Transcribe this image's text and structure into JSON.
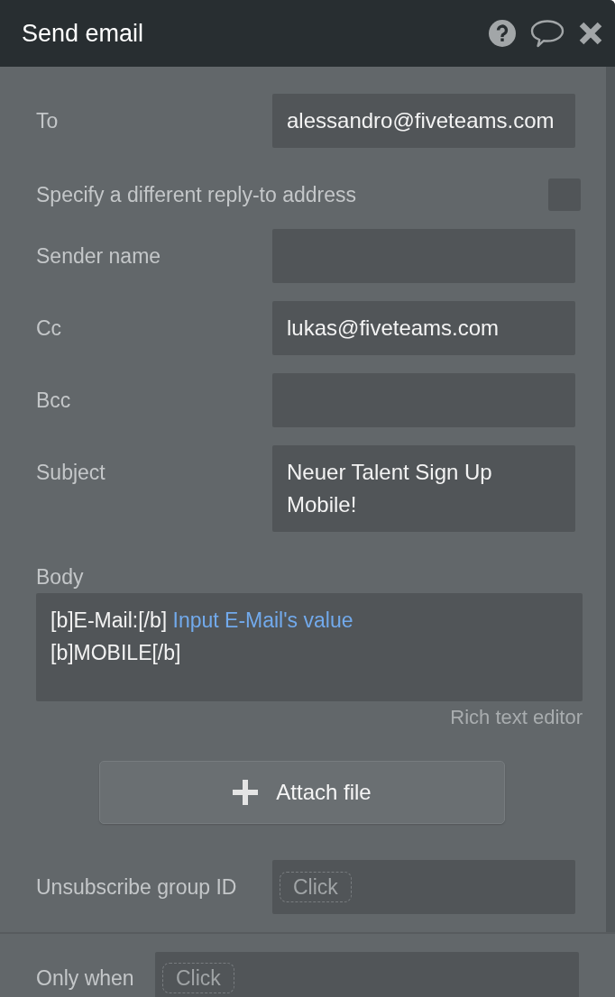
{
  "window": {
    "title": "Send email"
  },
  "fields": [
    {
      "kind": "text",
      "label": "To",
      "value": "alessandro@fiveteams.com"
    },
    {
      "kind": "checkbox",
      "label": "Specify a different reply-to address",
      "checked": false
    },
    {
      "kind": "text",
      "label": "Sender name"
    },
    {
      "kind": "text",
      "label": "Cc",
      "value": "lukas@fiveteams.com"
    },
    {
      "kind": "text",
      "label": "Bcc"
    },
    {
      "kind": "text",
      "label": "Subject",
      "value": "Neuer Talent Sign Up Mobile!"
    }
  ],
  "body": {
    "label": "Body",
    "lines": [
      {
        "segments": [
          {
            "kind": "plain",
            "text": "[b]E-Mail:[/b]"
          },
          {
            "kind": "expression",
            "text": "Input E-Mail's value"
          }
        ]
      },
      {
        "segments": [
          {
            "kind": "plain",
            "text": "[b]MOBILE[/b]"
          }
        ]
      }
    ],
    "editor_link": "Rich text editor"
  },
  "attach_button": {
    "label": "Attach file"
  },
  "unsubscribe": {
    "label": "Unsubscribe group ID",
    "button": "Click"
  },
  "condition": {
    "label": "Only when",
    "button": "Click"
  }
}
